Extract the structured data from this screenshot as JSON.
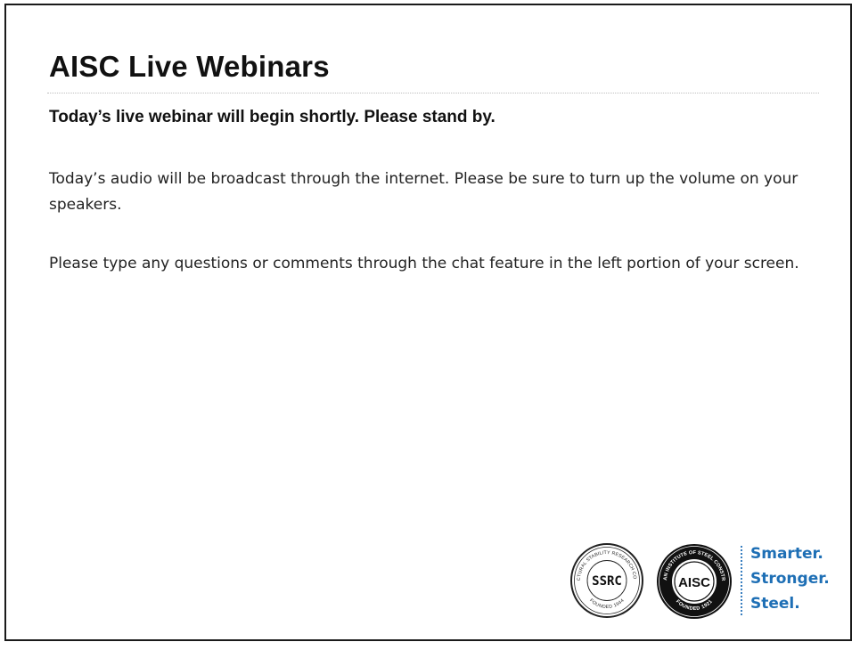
{
  "slide": {
    "title": "AISC Live Webinars",
    "subtitle": "Today’s live webinar will begin shortly.  Please stand by.",
    "paragraphs": [
      "Today’s audio will be broadcast through the internet.  Please be sure to turn up the volume on your speakers.",
      "Please type any questions or comments through the chat feature in the left portion of your screen."
    ]
  },
  "logos": {
    "ssrc_seal": {
      "center_text": "SSRC",
      "ring_text_top": "STRUCTURAL STABILITY RESEARCH COUNCIL",
      "ring_text_bottom": "FOUNDED 1944"
    },
    "aisc_seal": {
      "center_text": "AISC",
      "ring_text_top": "AMERICAN INSTITUTE OF STEEL CONSTRUCTION",
      "ring_text_bottom": "FOUNDED 1921"
    },
    "tagline": [
      "Smarter.",
      "Stronger.",
      "Steel."
    ],
    "tagline_color": "#1e6fb5"
  }
}
